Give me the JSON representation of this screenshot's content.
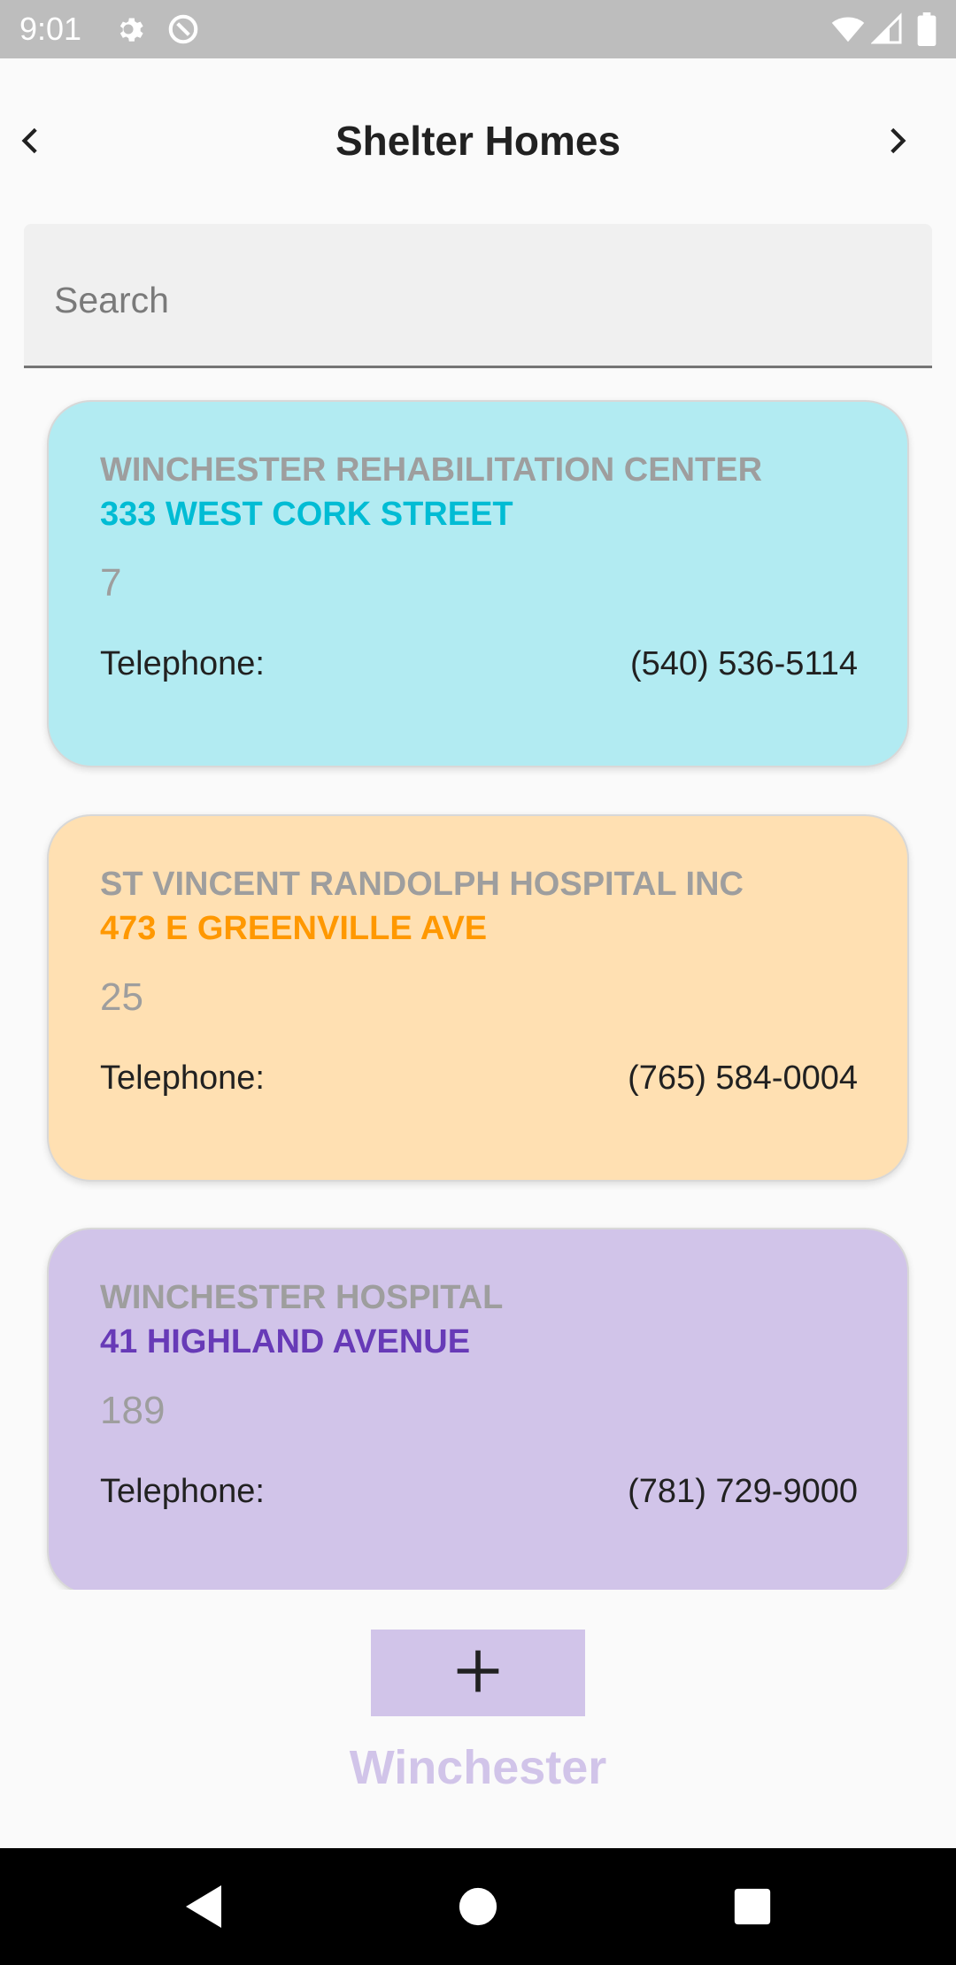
{
  "status_bar": {
    "time": "9:01",
    "icons": [
      "gear-icon",
      "data-saver-icon",
      "wifi-icon",
      "signal-icon",
      "battery-icon"
    ]
  },
  "app_bar": {
    "title": "Shelter Homes",
    "back_icon": "chevron-left-icon",
    "forward_icon": "chevron-right-icon"
  },
  "search": {
    "placeholder": "Search",
    "value": ""
  },
  "cards": [
    {
      "name": "WINCHESTER REHABILITATION CENTER",
      "address": "333 WEST CORK STREET",
      "number": "7",
      "telephone_label": "Telephone:",
      "telephone": "(540) 536-5114",
      "background_color": "#b2ebf2",
      "accent_color": "#00bcd4"
    },
    {
      "name": "ST VINCENT RANDOLPH HOSPITAL INC",
      "address": "473 E GREENVILLE AVE",
      "number": "25",
      "telephone_label": "Telephone:",
      "telephone": "(765) 584-0004",
      "background_color": "#ffe0b2",
      "accent_color": "#ff9800"
    },
    {
      "name": "WINCHESTER HOSPITAL",
      "address": "41 HIGHLAND AVENUE",
      "number": "189",
      "telephone_label": "Telephone:",
      "telephone": "(781) 729-9000",
      "background_color": "#d1c4e9",
      "accent_color": "#673ab7"
    }
  ],
  "footer": {
    "add_icon": "plus-icon",
    "label": "Winchester",
    "button_color": "#d1c4e9"
  },
  "nav_bar": {
    "icons": [
      "back-triangle-icon",
      "home-circle-icon",
      "recents-square-icon"
    ]
  }
}
